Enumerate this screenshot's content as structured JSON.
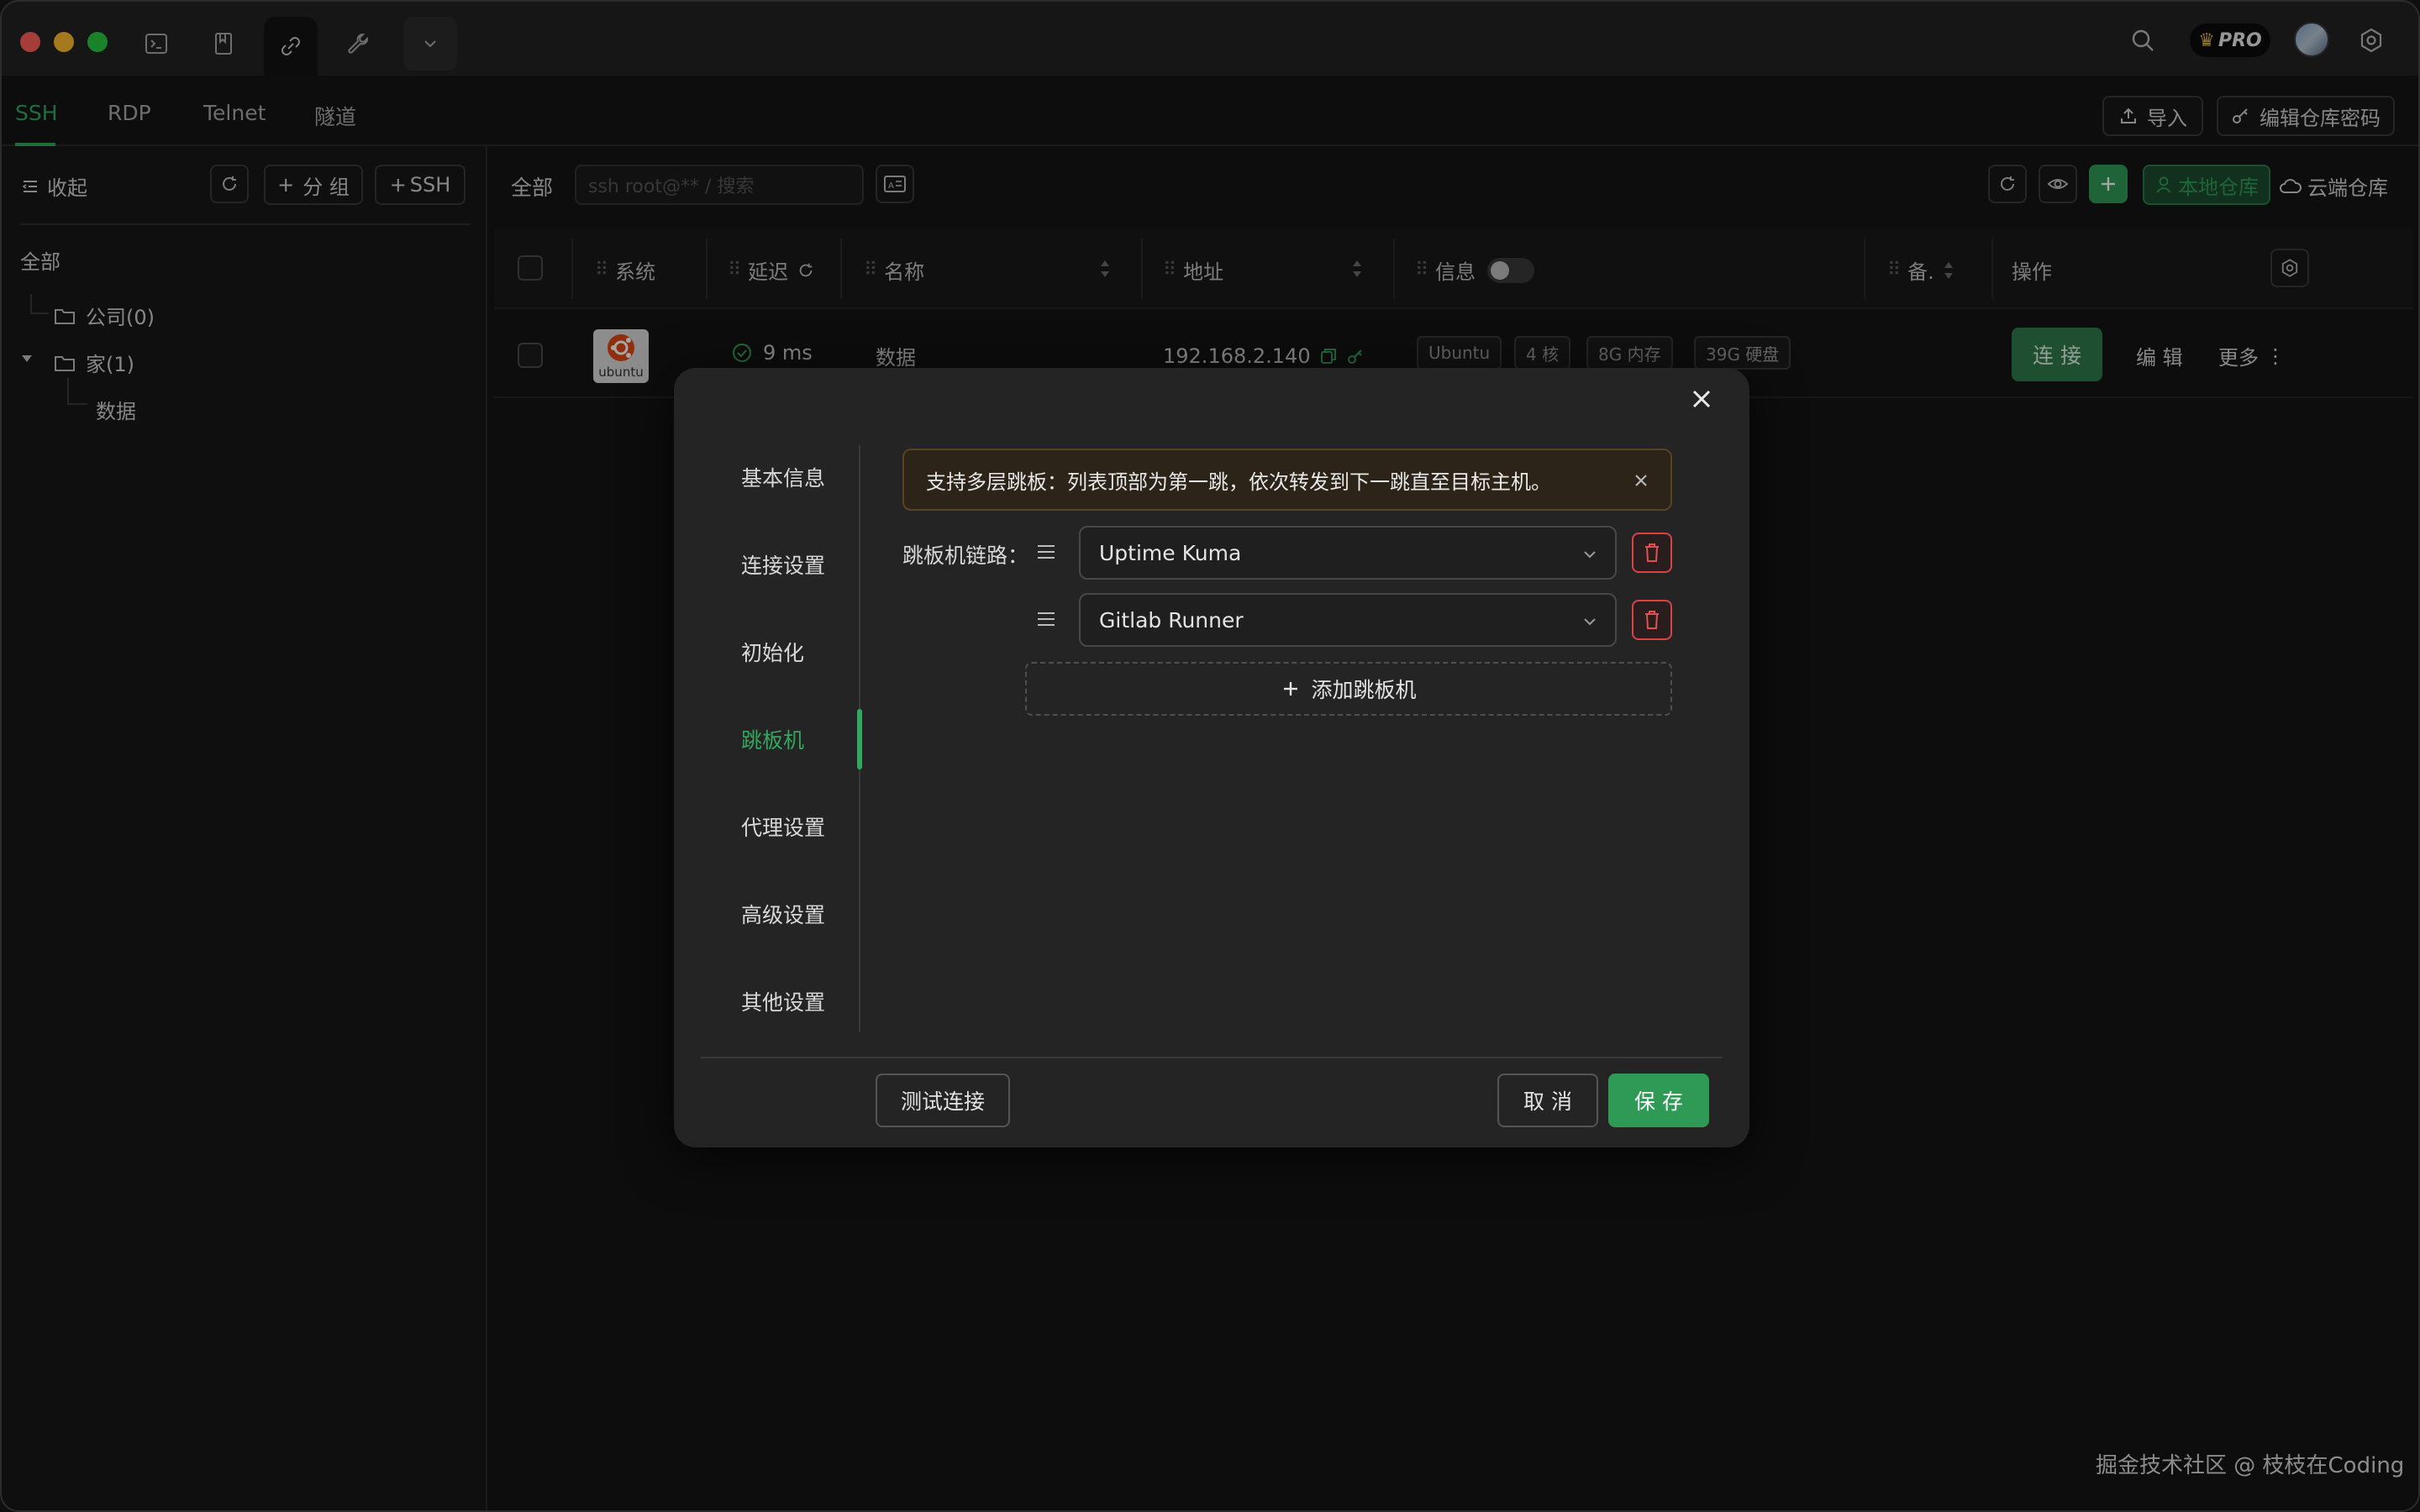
{
  "protocol_tabs": [
    "SSH",
    "RDP",
    "Telnet",
    "隧道"
  ],
  "header_actions": {
    "import": "导入",
    "edit_vault_password": "编辑仓库密码"
  },
  "pro_label": "PRO",
  "sidebar": {
    "collapse": "收起",
    "add_group": "分 组",
    "add_ssh": "SSH",
    "all": "全部",
    "tree": [
      {
        "label": "公司(0)"
      },
      {
        "label": "家(1)",
        "children": [
          {
            "label": "数据"
          }
        ]
      }
    ]
  },
  "main": {
    "filter_all": "全部",
    "search_placeholder": "ssh root@** / 搜索",
    "local_vault": "本地仓库",
    "cloud_vault": "云端仓库",
    "columns": {
      "system": "系统",
      "latency": "延迟",
      "name": "名称",
      "address": "地址",
      "info": "信息",
      "note": "备.",
      "actions": "操作"
    },
    "row": {
      "os_logo_text": "ubuntu",
      "latency": "9 ms",
      "name": "数据",
      "address": "192.168.2.140",
      "tags": [
        "Ubuntu",
        "4 核",
        "8G 内存",
        "39G 硬盘"
      ],
      "connect": "连 接",
      "edit": "编 辑",
      "more": "更多"
    }
  },
  "modal": {
    "nav": [
      "基本信息",
      "连接设置",
      "初始化",
      "跳板机",
      "代理设置",
      "高级设置",
      "其他设置"
    ],
    "active_nav": "跳板机",
    "alert": "支持多层跳板：列表顶部为第一跳，依次转发到下一跳直至目标主机。",
    "chain_label": "跳板机链路：",
    "jump_hosts": [
      "Uptime Kuma",
      "Gitlab Runner"
    ],
    "add_jump": "添加跳板机",
    "test_connection": "测试连接",
    "cancel": "取 消",
    "save": "保 存"
  },
  "watermark": "掘金技术社区 @ 枝枝在Coding",
  "colors": {
    "accent": "#33a75f",
    "danger": "#d64545",
    "alert_bg": "#2c2418"
  }
}
